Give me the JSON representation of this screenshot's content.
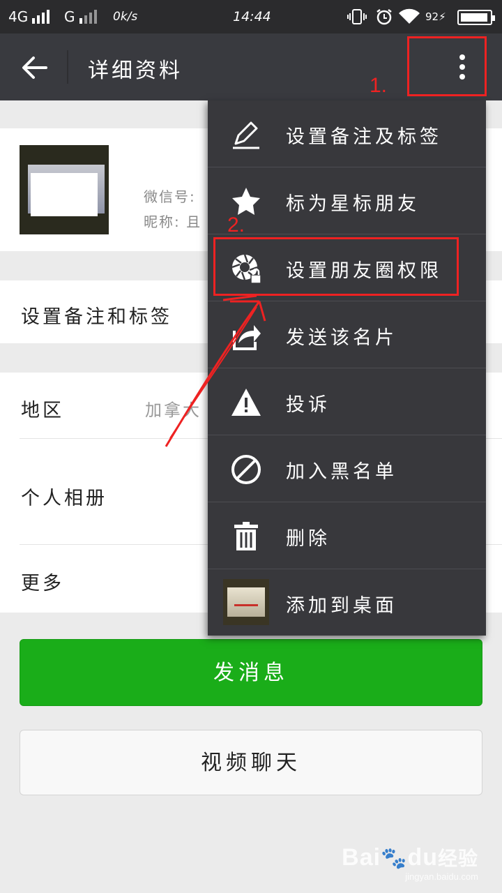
{
  "status_bar": {
    "network_1": "4G",
    "network_2": "G",
    "speed": "0k/s",
    "time": "14:44",
    "battery": "92"
  },
  "header": {
    "title": "详细资料"
  },
  "profile": {
    "wechat_id_label": "微信号:",
    "nickname_label": "昵称: 且"
  },
  "rows": {
    "remark_label": "设置备注和标签",
    "region_label": "地区",
    "region_value": "加拿大",
    "album_label": "个人相册",
    "more_label": "更多"
  },
  "buttons": {
    "send_message": "发消息",
    "video_call": "视频聊天"
  },
  "menu": {
    "items": [
      {
        "label": "设置备注及标签",
        "icon": "pencil-icon"
      },
      {
        "label": "标为星标朋友",
        "icon": "star-icon"
      },
      {
        "label": "设置朋友圈权限",
        "icon": "moments-lock-icon"
      },
      {
        "label": "发送该名片",
        "icon": "share-icon"
      },
      {
        "label": "投诉",
        "icon": "warning-icon"
      },
      {
        "label": "加入黑名单",
        "icon": "block-icon"
      },
      {
        "label": "删除",
        "icon": "trash-icon"
      },
      {
        "label": "添加到桌面",
        "icon": "contact-thumbnail"
      }
    ]
  },
  "annotations": {
    "step1": "1.",
    "step2": "2.",
    "color": "#e22222"
  },
  "watermark": {
    "brand": "Bai",
    "brand_suffix": "du",
    "product": "经验",
    "url": "jingyan.baidu.com"
  },
  "colors": {
    "topbar": "#393a3f",
    "menu": "#38383c",
    "green_button": "#1aad19"
  }
}
